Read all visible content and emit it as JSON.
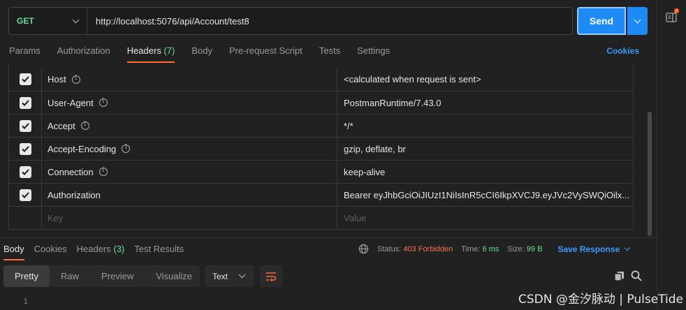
{
  "request": {
    "method": "GET",
    "url": "http://localhost:5076/api/Account/test8",
    "send_label": "Send"
  },
  "tabs": [
    {
      "label": "Params"
    },
    {
      "label": "Authorization"
    },
    {
      "label": "Headers",
      "count": "(7)"
    },
    {
      "label": "Body"
    },
    {
      "label": "Pre-request Script"
    },
    {
      "label": "Tests"
    },
    {
      "label": "Settings"
    }
  ],
  "cookies_label": "Cookies",
  "headers": [
    {
      "key": "Host",
      "value": "<calculated when request is sent>"
    },
    {
      "key": "User-Agent",
      "value": "PostmanRuntime/7.43.0"
    },
    {
      "key": "Accept",
      "value": "*/*"
    },
    {
      "key": "Accept-Encoding",
      "value": "gzip, deflate, br"
    },
    {
      "key": "Connection",
      "value": "keep-alive"
    },
    {
      "key": "Authorization",
      "value": "Bearer eyJhbGciOiJIUzI1NiIsInR5cCI6IkpXVCJ9.eyJVc2VySWQiOilx..."
    }
  ],
  "new_row": {
    "key_placeholder": "Key",
    "value_placeholder": "Value"
  },
  "response": {
    "tabs": [
      {
        "label": "Body"
      },
      {
        "label": "Cookies"
      },
      {
        "label": "Headers",
        "count": "(3)"
      },
      {
        "label": "Test Results"
      }
    ],
    "status_label": "Status:",
    "status_value": "403 Forbidden",
    "time_label": "Time:",
    "time_value": "6 ms",
    "size_label": "Size:",
    "size_value": "99 B",
    "save_label": "Save Response",
    "views": [
      "Pretty",
      "Raw",
      "Preview",
      "Visualize"
    ],
    "format": "Text",
    "line_number": "1"
  },
  "watermark": "CSDN @金汐脉动 | PulseTide",
  "colors": {
    "accent": "#ff6c37",
    "send": "#1d8af5",
    "method": "#6bdd9a",
    "link": "#3e9bff",
    "error": "#f76f5a"
  }
}
